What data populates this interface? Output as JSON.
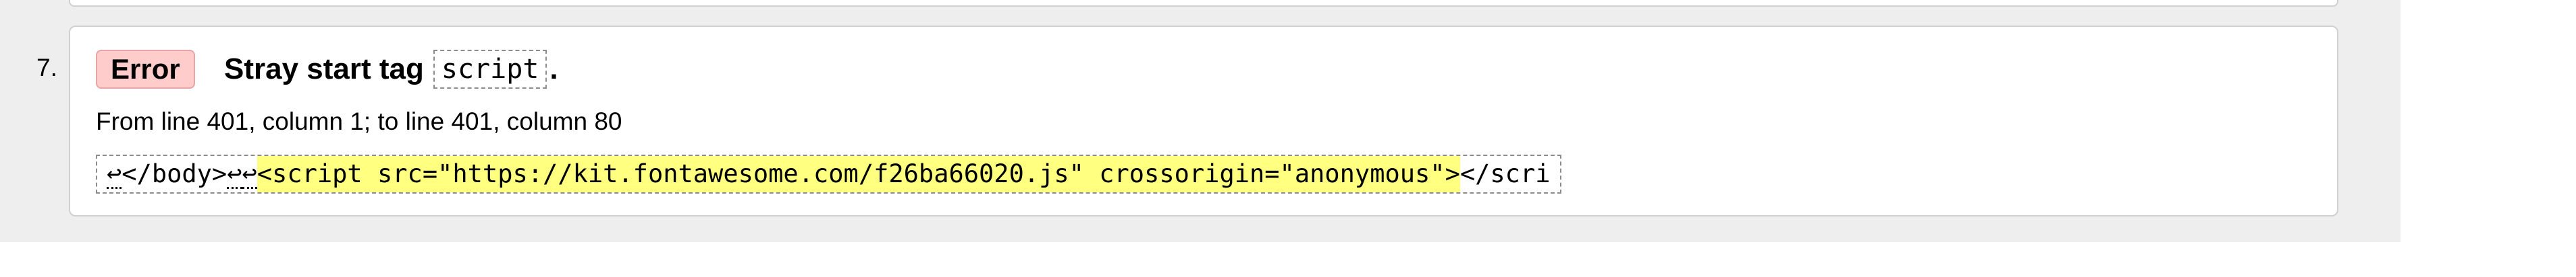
{
  "messages": [
    {
      "number": "7.",
      "type": "Error",
      "message_text": "Stray start tag",
      "code": "script",
      "message_end": ".",
      "location": "From line 401, column 1; to line 401, column 80",
      "extract": {
        "line_break_glyph": "↩",
        "before": "</body>",
        "highlighted": "<script src=\"https://kit.fontawesome.com/f26ba66020.js\" crossorigin=\"anonymous\">",
        "after": "</scri"
      }
    }
  ],
  "colors": {
    "page_band": "#eeeeee",
    "error_badge_bg": "#ffcccc",
    "highlight": "#ffff80"
  },
  "icons": {
    "line_break": "return-arrow-icon"
  }
}
